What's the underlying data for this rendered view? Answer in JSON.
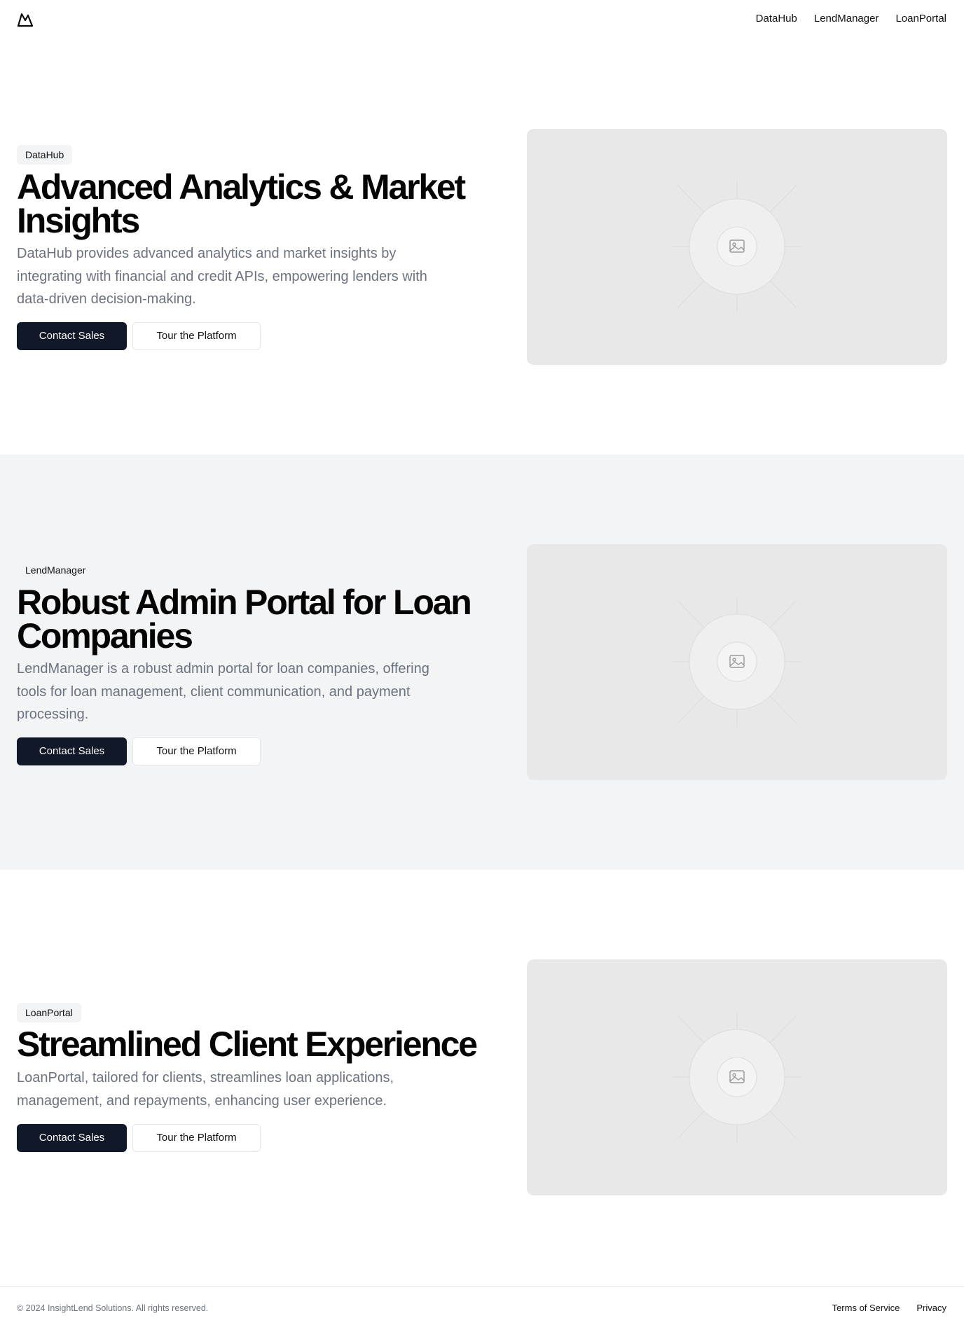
{
  "nav": {
    "logo": "mountain-logo-icon",
    "links": [
      "DataHub",
      "LendManager",
      "LoanPortal"
    ]
  },
  "sections": [
    {
      "badge": "DataHub",
      "title": "Advanced Analytics & Market Insights",
      "description": "DataHub provides advanced analytics and market insights by integrating with financial and credit APIs, empowering lenders with data-driven decision-making.",
      "primary_cta": "Contact Sales",
      "secondary_cta": "Tour the Platform",
      "image": "image-placeholder-icon"
    },
    {
      "badge": "LendManager",
      "title": "Robust Admin Portal for Loan Companies",
      "description": "LendManager is a robust admin portal for loan companies, offering tools for loan management, client communication, and payment processing.",
      "primary_cta": "Contact Sales",
      "secondary_cta": "Tour the Platform",
      "image": "image-placeholder-icon"
    },
    {
      "badge": "LoanPortal",
      "title": "Streamlined Client Experience",
      "description": "LoanPortal, tailored for clients, streamlines loan applications, management, and repayments, enhancing user experience.",
      "primary_cta": "Contact Sales",
      "secondary_cta": "Tour the Platform",
      "image": "image-placeholder-icon"
    }
  ],
  "footer": {
    "copyright": "© 2024 InsightLend Solutions. All rights reserved.",
    "links": [
      "Terms of Service",
      "Privacy"
    ]
  },
  "colors": {
    "primary_button": "#111827",
    "alt_section_bg": "#f3f4f6",
    "placeholder_bg": "#e8e8e8",
    "body_text_muted": "#6b7280"
  }
}
